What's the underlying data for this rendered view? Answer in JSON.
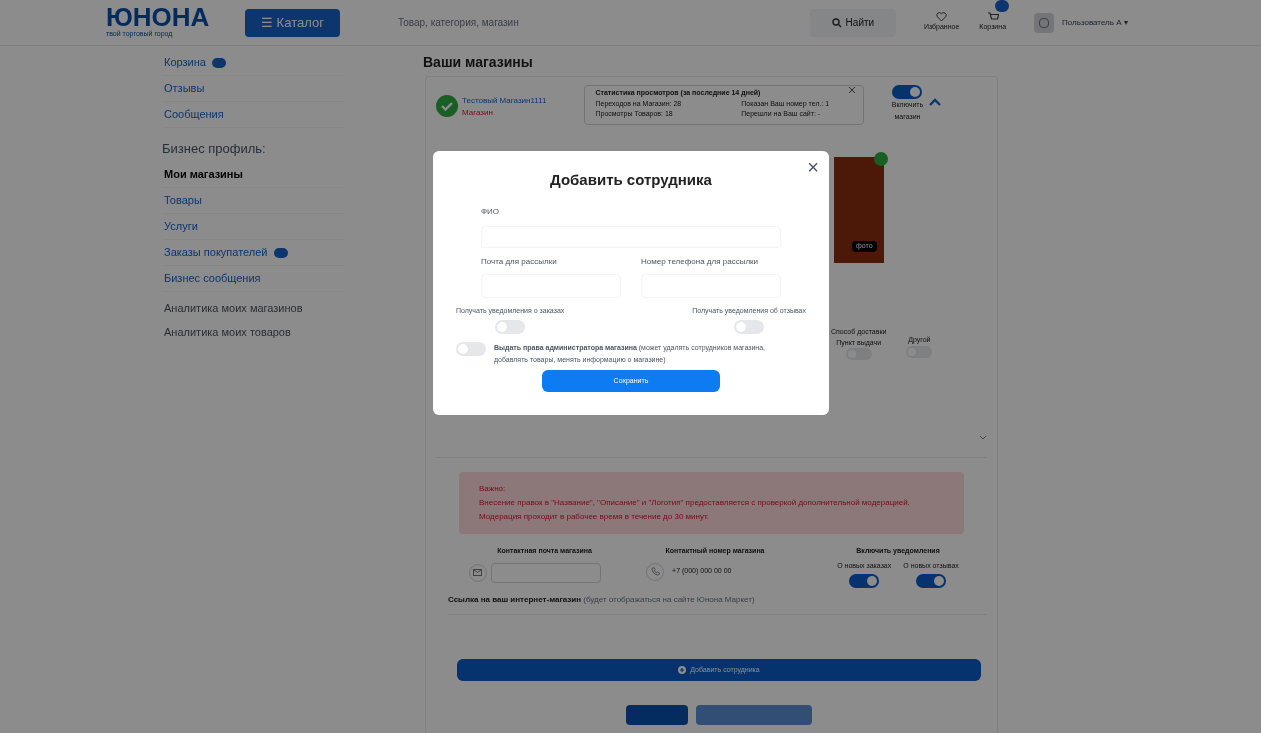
{
  "header": {
    "logo": "ЮНОНА",
    "tagline": "твой торговый город",
    "catalog_button": "☰ Каталог",
    "search": {
      "placeholder": "Товар, категория, магазин"
    },
    "search_button": "Найти",
    "favorites": "Избранное",
    "cart": "Корзина",
    "user": "Пользователь А ▾"
  },
  "sidebar": {
    "items": [
      {
        "label": "Корзина",
        "badge": true,
        "selected": false
      },
      {
        "label": "Отзывы",
        "badge": false,
        "selected": false
      },
      {
        "label": "Сообщения",
        "badge": false,
        "selected": false
      }
    ],
    "section": "Бизнес профиль:",
    "business_items": [
      {
        "label": "Мои магазины",
        "badge": false,
        "selected": true
      },
      {
        "label": "Товары",
        "badge": false,
        "selected": false
      },
      {
        "label": "Услуги",
        "badge": false,
        "selected": false
      },
      {
        "label": "Заказы покупателей",
        "badge": true,
        "selected": false
      },
      {
        "label": "Бизнес сообщения",
        "badge": false,
        "selected": false
      }
    ],
    "analytics": [
      "Аналитика моих магазинов",
      "Аналитика моих товаров"
    ]
  },
  "page_title": "Ваши магазины",
  "store": {
    "name": "Тестовый Магазин1111",
    "type": "Магазин",
    "stats": {
      "title": "Статистика просмотров (за последние 14 дней)",
      "lines": [
        "Переходов на Магазин: 28",
        "Показан Ваш номер тел.: 1",
        "Просмотры Товаров: 18",
        "Перешли на Ваш сайт: -"
      ]
    },
    "enabled": {
      "label": "Включить магазин",
      "on": true
    },
    "photo_count": "фото",
    "delivery": {
      "title": "Способ доставки",
      "options": [
        {
          "label": "Пункт выдачи",
          "on": false
        },
        {
          "label": "Другой",
          "on": false
        }
      ]
    },
    "notice": {
      "title": "Важно:",
      "lines": [
        "Внесение правок в \"Название\", \"Описание\" и \"Логотип\" предоставляется с проверкой дополнительной модерацией.",
        "Модерация проходит в рабочее время в течение до 30 минут."
      ]
    },
    "contact_email_label": "Контактная почта магазина",
    "contact_phone_label": "Контактный номер магазина",
    "contact_phone": "+7 (000) 000 00 00",
    "notifications": {
      "title": "Включить уведомления",
      "toggles": [
        {
          "label": "О новых заказах",
          "on": true
        },
        {
          "label": "О новых отзывах",
          "on": true
        }
      ]
    },
    "website_label": "Ссылка на ваш интернет-магазин",
    "website_hint": "(будет отображаться на сайте Юнона Маркет)",
    "add_employee_button": "Добавить сотрудника"
  },
  "modal": {
    "title": "Добавить сотрудника",
    "close": "×",
    "name_label": "ФИО",
    "email_label": "Почта для рассылки",
    "phone_label": "Номер телефона для рассылки",
    "toggles": [
      {
        "label": "Получать уведомления о заказах",
        "on": false
      },
      {
        "label": "Получать уведомления об отзывах",
        "on": false
      }
    ],
    "admin": {
      "text": "**Выдать права администратора магазина** (может удалять сотрудников магазина, добавлять товары, менять информацию о магазине)",
      "on": false
    },
    "save_button": "Сохранить"
  }
}
